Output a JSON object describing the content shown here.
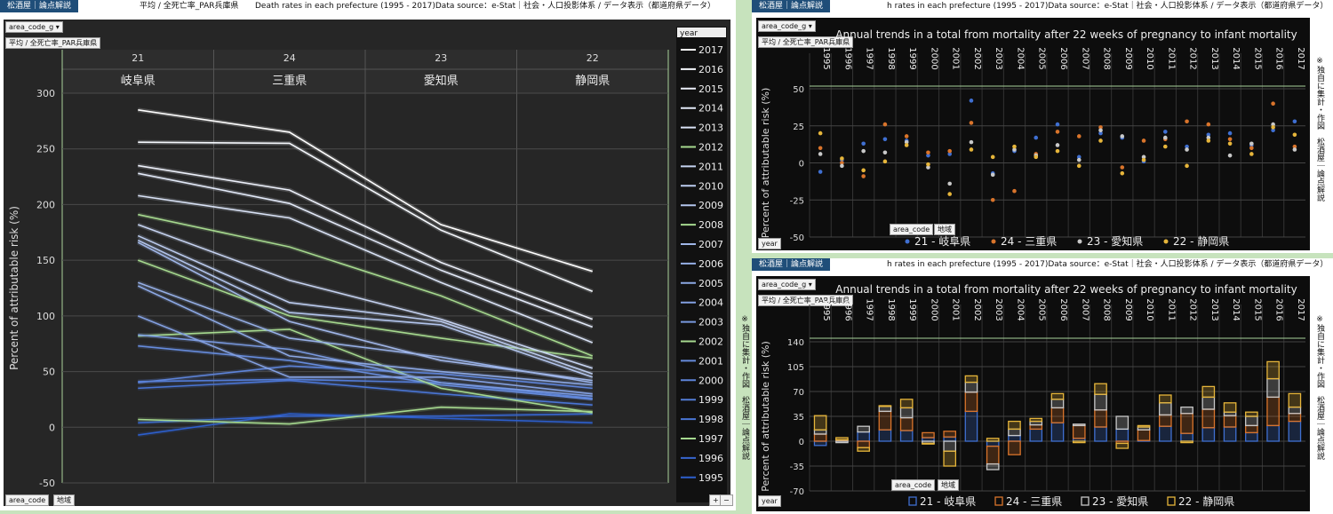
{
  "left": {
    "tag": "松酒屋｜論点解説",
    "crumbs": [
      "平均 / 全死亡率_PAR兵庫県",
      "Death rates in each prefecture (1995 - 2017)Data source：e-Stat｜社会・人口投影体系 / データ表示（都道府県データ）"
    ],
    "filter_button": "area_code_g",
    "measure_button": "平均 / 全死亡率_PAR兵庫県",
    "legend_header": "year",
    "bottom_buttons": [
      "area_code",
      "地域"
    ],
    "zoom_buttons": [
      "+",
      "−"
    ],
    "side_text": "※独自に集計・作図　松酒屋｜論点解説"
  },
  "right": {
    "tag": "松酒屋｜論点解説",
    "crumb": "h rates in each prefecture (1995 - 2017)Data source：e-Stat｜社会・人口投影体系 / データ表示（都道府県データ）",
    "filter_button": "area_code_g",
    "measure_button": "平均 / 全死亡率_PAR兵庫県",
    "year_button": "year",
    "bottom_buttons": [
      "area_code",
      "地域"
    ],
    "side_text": "※独自に集計・作図　松酒屋｜論点解説"
  },
  "colors": {
    "岐阜県": "#3f6fd1",
    "三重県": "#d9742b",
    "愛知県": "#c8c8c8",
    "静岡県": "#e6b53a"
  },
  "chart_data": [
    {
      "type": "line",
      "ylabel": "Percent of attributable risk (%)",
      "ylim": [
        -50,
        300
      ],
      "yticks": [
        -50,
        0,
        50,
        100,
        150,
        200,
        250,
        300
      ],
      "categories": [
        "岐阜県",
        "三重県",
        "愛知県",
        "静岡県"
      ],
      "category_codes": [
        "21",
        "24",
        "23",
        "22"
      ],
      "legend_title": "year",
      "series": [
        {
          "name": "2017",
          "values": [
            285,
            265,
            182,
            140
          ]
        },
        {
          "name": "2016",
          "values": [
            256,
            255,
            177,
            122
          ]
        },
        {
          "name": "2015",
          "values": [
            235,
            213,
            148,
            97
          ]
        },
        {
          "name": "2014",
          "values": [
            228,
            201,
            141,
            90
          ]
        },
        {
          "name": "2013",
          "values": [
            208,
            188,
            130,
            76
          ]
        },
        {
          "name": "2012",
          "values": [
            191,
            162,
            118,
            64
          ]
        },
        {
          "name": "2011",
          "values": [
            182,
            132,
            97,
            53
          ]
        },
        {
          "name": "2010",
          "values": [
            172,
            112,
            95,
            48
          ]
        },
        {
          "name": "2009",
          "values": [
            168,
            103,
            92,
            45
          ]
        },
        {
          "name": "2008",
          "values": [
            150,
            100,
            80,
            62
          ]
        },
        {
          "name": "2007",
          "values": [
            166,
            95,
            60,
            42
          ]
        },
        {
          "name": "2006",
          "values": [
            130,
            80,
            63,
            40
          ]
        },
        {
          "name": "2005",
          "values": [
            127,
            64,
            50,
            38
          ]
        },
        {
          "name": "2004",
          "values": [
            100,
            45,
            45,
            30
          ]
        },
        {
          "name": "2003",
          "values": [
            83,
            70,
            40,
            28
          ]
        },
        {
          "name": "2002",
          "values": [
            82,
            88,
            35,
            13
          ]
        },
        {
          "name": "2001",
          "values": [
            73,
            60,
            38,
            25
          ]
        },
        {
          "name": "2000",
          "values": [
            40,
            55,
            48,
            35
          ]
        },
        {
          "name": "1999",
          "values": [
            41,
            43,
            40,
            26
          ]
        },
        {
          "name": "1998",
          "values": [
            35,
            42,
            30,
            20
          ]
        },
        {
          "name": "1997",
          "values": [
            7,
            3,
            18,
            14
          ]
        },
        {
          "name": "1996",
          "values": [
            4,
            10,
            10,
            12
          ]
        },
        {
          "name": "1995",
          "values": [
            -7,
            12,
            8,
            4
          ]
        }
      ]
    },
    {
      "type": "scatter",
      "title": "Annual trends in a total from mortality after 22 weeks of pregnancy to infant mortality",
      "ylabel": "Percent of attributable risk (%)",
      "ylim": [
        -50,
        50
      ],
      "yticks": [
        -50,
        -25,
        0,
        25,
        50
      ],
      "x": [
        "1995",
        "1996",
        "1997",
        "1998",
        "1999",
        "2000",
        "2001",
        "2002",
        "2003",
        "2004",
        "2005",
        "2006",
        "2007",
        "2008",
        "2009",
        "2010",
        "2011",
        "2012",
        "2013",
        "2014",
        "2015",
        "2016",
        "2017"
      ],
      "series": [
        {
          "name": "21 - 岐阜県",
          "values": [
            -6,
            2,
            13,
            16,
            15,
            5,
            6,
            42,
            -7,
            8,
            17,
            26,
            4,
            20,
            17,
            1,
            21,
            11,
            19,
            20,
            12,
            22,
            28
          ]
        },
        {
          "name": "24 - 三重県",
          "values": [
            10,
            0,
            -9,
            26,
            18,
            7,
            8,
            27,
            -25,
            -19,
            6,
            21,
            18,
            24,
            -3,
            15,
            16,
            28,
            26,
            16,
            10,
            40,
            11
          ]
        },
        {
          "name": "23 - 愛知県",
          "values": [
            6,
            -2,
            8,
            7,
            14,
            -3,
            -14,
            14,
            -8,
            9,
            5,
            12,
            2,
            22,
            18,
            4,
            17,
            9,
            17,
            5,
            13,
            26,
            9
          ]
        },
        {
          "name": "22 - 静岡県",
          "values": [
            20,
            3,
            -5,
            1,
            12,
            -1,
            -21,
            9,
            4,
            11,
            4,
            8,
            -2,
            15,
            -7,
            2,
            11,
            -2,
            15,
            13,
            6,
            24,
            19
          ]
        }
      ]
    },
    {
      "type": "bar",
      "title": "Annual trends in a total from mortality after 22 weeks of pregnancy to infant mortality",
      "ylabel": "Percent of attributable risk (%)",
      "ylim": [
        -70,
        140
      ],
      "yticks": [
        -70,
        -35,
        0,
        35,
        70,
        105,
        140
      ],
      "stacked": true,
      "x": [
        "1995",
        "1996",
        "1997",
        "1998",
        "1999",
        "2000",
        "2001",
        "2002",
        "2003",
        "2004",
        "2005",
        "2006",
        "2007",
        "2008",
        "2009",
        "2010",
        "2011",
        "2012",
        "2013",
        "2014",
        "2015",
        "2016",
        "2017"
      ],
      "series": [
        {
          "name": "21 - 岐阜県",
          "values": [
            -6,
            2,
            13,
            16,
            15,
            5,
            6,
            42,
            -7,
            8,
            17,
            26,
            4,
            20,
            17,
            1,
            21,
            11,
            19,
            20,
            12,
            22,
            28
          ]
        },
        {
          "name": "24 - 三重県",
          "values": [
            10,
            0,
            -9,
            26,
            18,
            7,
            8,
            27,
            -25,
            -19,
            6,
            21,
            18,
            24,
            -3,
            15,
            16,
            28,
            26,
            16,
            10,
            40,
            11
          ]
        },
        {
          "name": "23 - 愛知県",
          "values": [
            6,
            -2,
            8,
            7,
            14,
            -3,
            -14,
            14,
            -8,
            9,
            5,
            12,
            2,
            22,
            18,
            4,
            17,
            9,
            17,
            5,
            13,
            26,
            9
          ]
        },
        {
          "name": "22 - 静岡県",
          "values": [
            20,
            3,
            -5,
            1,
            12,
            -1,
            -21,
            9,
            4,
            11,
            4,
            8,
            -2,
            15,
            -7,
            2,
            11,
            -2,
            15,
            13,
            6,
            24,
            19
          ]
        }
      ]
    }
  ]
}
